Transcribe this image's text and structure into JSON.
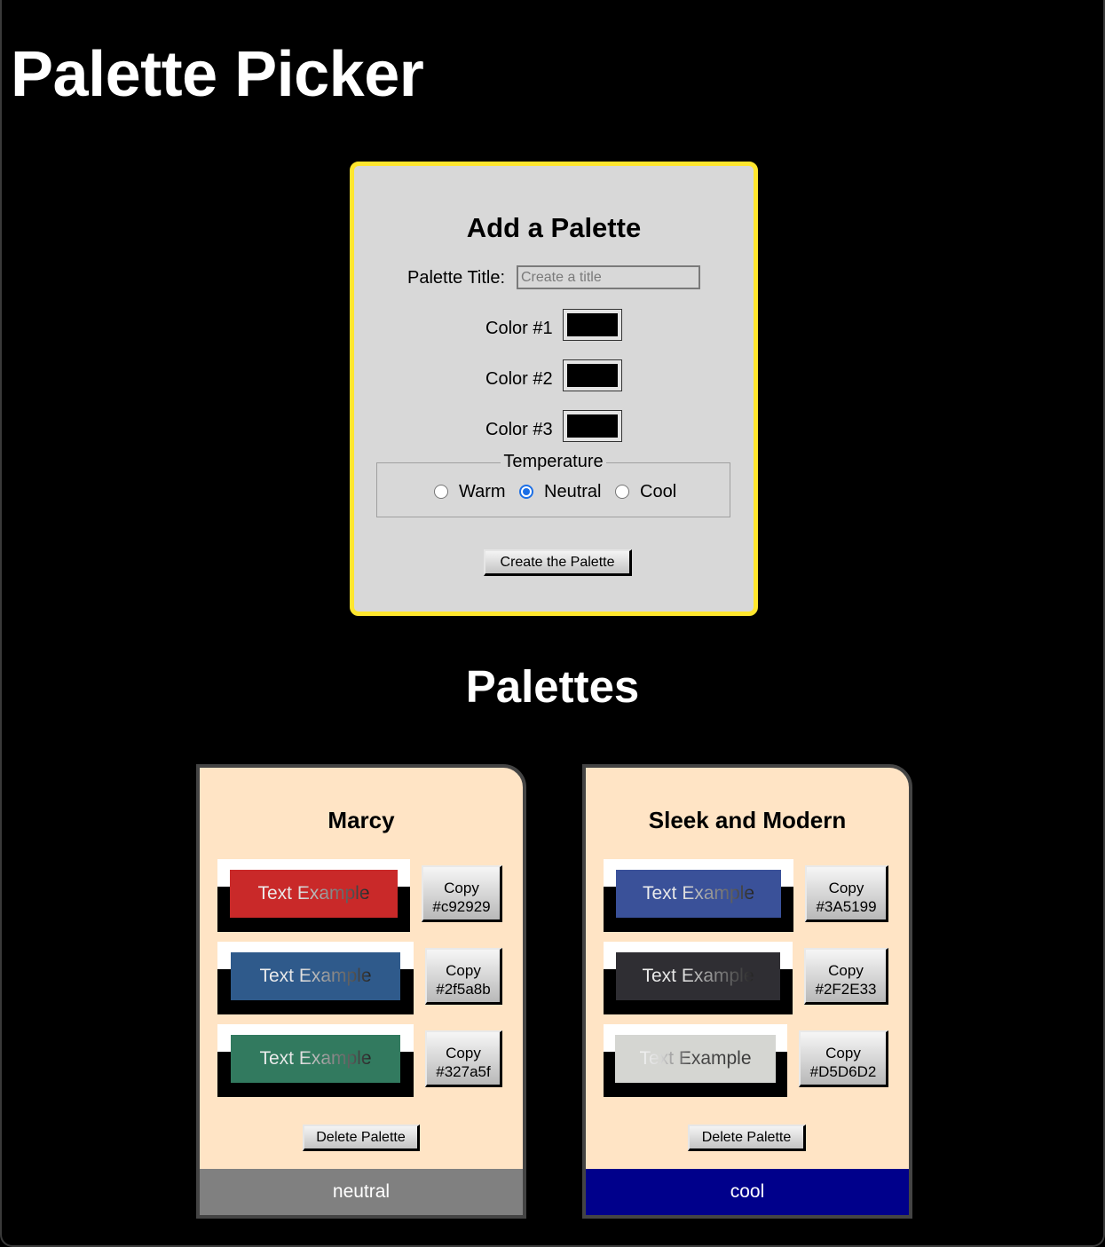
{
  "app": {
    "title": "Palette Picker"
  },
  "form": {
    "heading": "Add a Palette",
    "title_label": "Palette Title:",
    "title_placeholder": "Create a title",
    "title_value": "",
    "colors": [
      {
        "label": "Color #1",
        "value": "#000000"
      },
      {
        "label": "Color #2",
        "value": "#000000"
      },
      {
        "label": "Color #3",
        "value": "#000000"
      }
    ],
    "temperature": {
      "legend": "Temperature",
      "options": [
        {
          "label": "Warm",
          "checked": false
        },
        {
          "label": "Neutral",
          "checked": true
        },
        {
          "label": "Cool",
          "checked": false
        }
      ]
    },
    "submit_label": "Create the Palette"
  },
  "palettes_heading": "Palettes",
  "palettes": [
    {
      "name": "Marcy",
      "swatches": [
        {
          "text": "Text Example",
          "color": "#c92929",
          "copy_label": "Copy",
          "code": "#c92929"
        },
        {
          "text": "Text Example",
          "color": "#2f5a8b",
          "copy_label": "Copy",
          "code": "#2f5a8b"
        },
        {
          "text": "Text Example",
          "color": "#327a5f",
          "copy_label": "Copy",
          "code": "#327a5f"
        }
      ],
      "delete_label": "Delete Palette",
      "temperature": "neutral",
      "temperature_color": "#808080"
    },
    {
      "name": "Sleek and Modern",
      "swatches": [
        {
          "text": "Text Example",
          "color": "#3A5199",
          "copy_label": "Copy",
          "code": "#3A5199"
        },
        {
          "text": "Text Example",
          "color": "#2F2E33",
          "copy_label": "Copy",
          "code": "#2F2E33"
        },
        {
          "text": "Text Example",
          "color": "#D5D6D2",
          "copy_label": "Copy",
          "code": "#D5D6D2"
        }
      ],
      "delete_label": "Delete Palette",
      "temperature": "cool",
      "temperature_color": "#00008b"
    }
  ],
  "colors": {
    "page_bg": "#000000",
    "form_border": "#ffe62e",
    "form_bg": "#d8d8d8",
    "card_bg": "#ffe4c5",
    "radio_accent": "#1c6fe6"
  }
}
